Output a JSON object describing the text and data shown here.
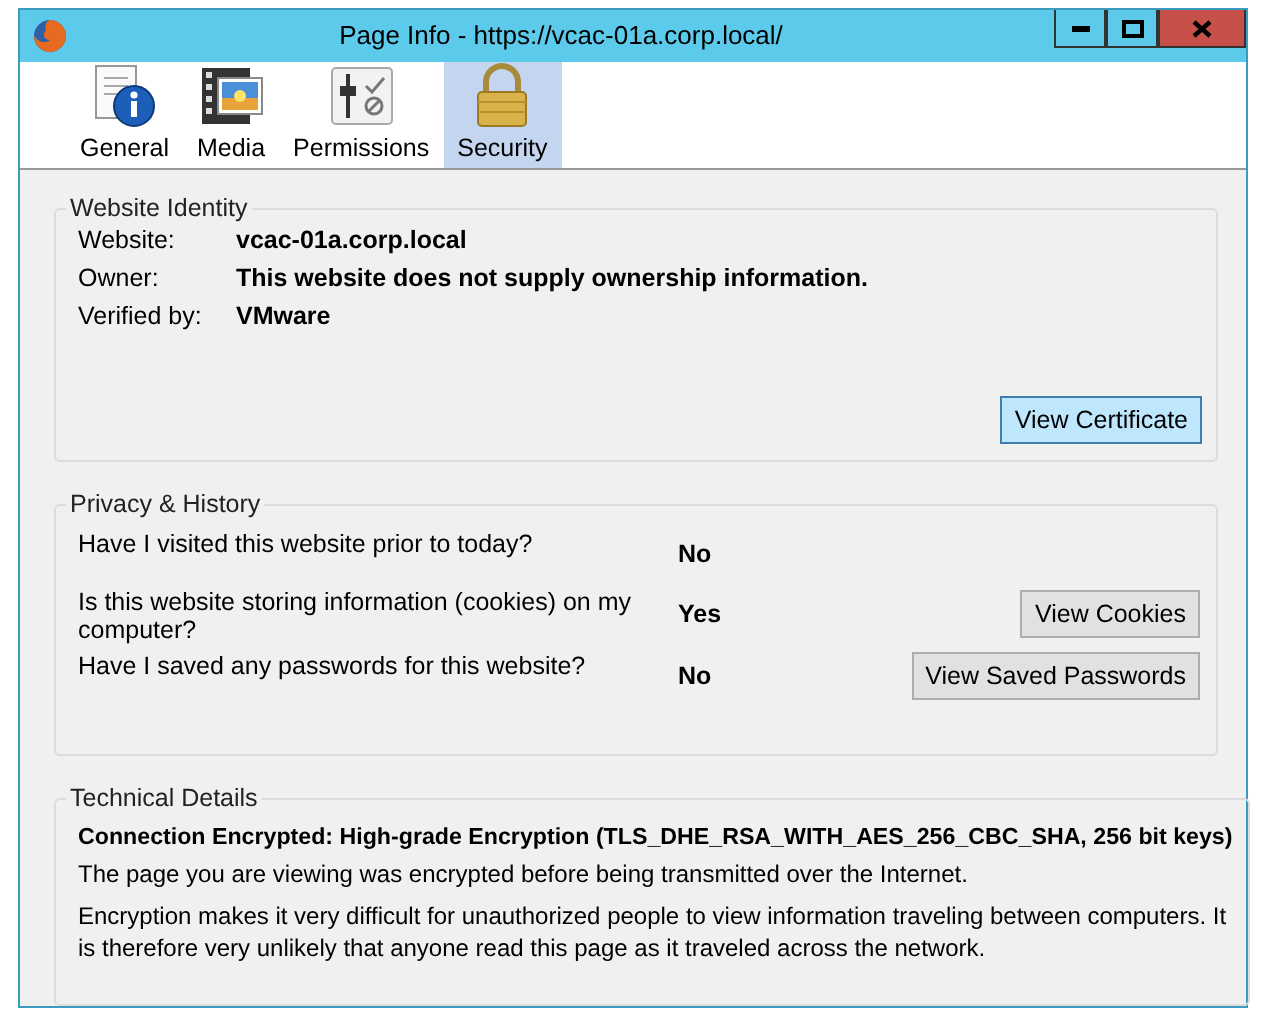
{
  "window": {
    "title": "Page Info - https://vcac-01a.corp.local/"
  },
  "tabs": [
    {
      "label": "General",
      "kind": "general",
      "selected": false
    },
    {
      "label": "Media",
      "kind": "media",
      "selected": false
    },
    {
      "label": "Permissions",
      "kind": "permissions",
      "selected": false
    },
    {
      "label": "Security",
      "kind": "security",
      "selected": true
    }
  ],
  "website_identity": {
    "title": "Website Identity",
    "fields": [
      {
        "label": "Website:",
        "value": "vcac-01a.corp.local"
      },
      {
        "label": "Owner:",
        "value": "This website does not supply ownership information."
      },
      {
        "label": "Verified by:",
        "value": "VMware"
      }
    ],
    "button": {
      "label": "View Certificate",
      "hovered": true
    }
  },
  "privacy_history": {
    "title": "Privacy & History",
    "rows": [
      {
        "question": "Have I visited this website prior to today?",
        "answer": "No"
      },
      {
        "question": "Is this website storing information (cookies) on my computer?",
        "answer": "Yes",
        "button": {
          "label": "View Cookies",
          "hovered": false
        }
      },
      {
        "question": "Have I saved any passwords for this website?",
        "answer": "No",
        "button": {
          "label": "View Saved Passwords",
          "hovered": false
        }
      }
    ]
  },
  "technical_details": {
    "title": "Technical Details",
    "heading": "Connection Encrypted: High-grade Encryption (TLS_DHE_RSA_WITH_AES_256_CBC_SHA, 256 bit keys)",
    "paragraphs": [
      "The page you are viewing was encrypted before being transmitted over the Internet.",
      "Encryption makes it very difficult for unauthorized people to view information traveling between computers. It is therefore very unlikely that anyone read this page as it traveled across the network."
    ]
  }
}
